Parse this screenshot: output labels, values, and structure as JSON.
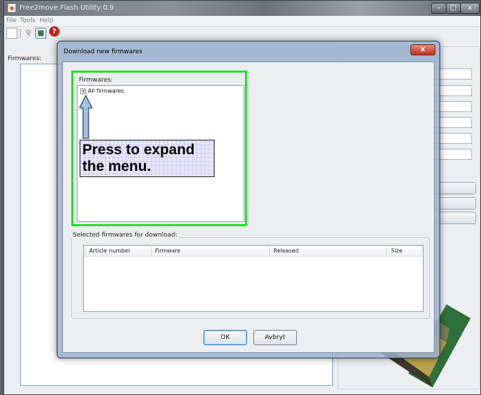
{
  "app": {
    "title": "Free2move Flash Utility 0.9",
    "menu": [
      "File",
      "Tools",
      "Help"
    ],
    "firmwares_label": "Firmwares:",
    "window_controls": {
      "minimize": "–",
      "maximize": "□",
      "close": "x"
    },
    "icons": [
      "java-icon",
      "new-document-icon",
      "search-icon",
      "download-firmware-icon",
      "help-icon"
    ]
  },
  "dialog": {
    "title": "Download new firmwares",
    "close_label": "x",
    "firmwares_label": "Firmwares:",
    "tree": {
      "expander": "+",
      "root_label": "All firmwares"
    },
    "callout": "Press to expand the menu.",
    "selected_label": "Selected firmwares for download:",
    "columns": [
      "Article number",
      "Firmware",
      "Released",
      "Size"
    ],
    "rows": [],
    "ok_label": "OK",
    "cancel_label": "Avbryt"
  },
  "colors": {
    "highlight_border": "#22e022",
    "callout_fill": "#e6e6fa",
    "arrow_fill": "#9cc4ea"
  }
}
